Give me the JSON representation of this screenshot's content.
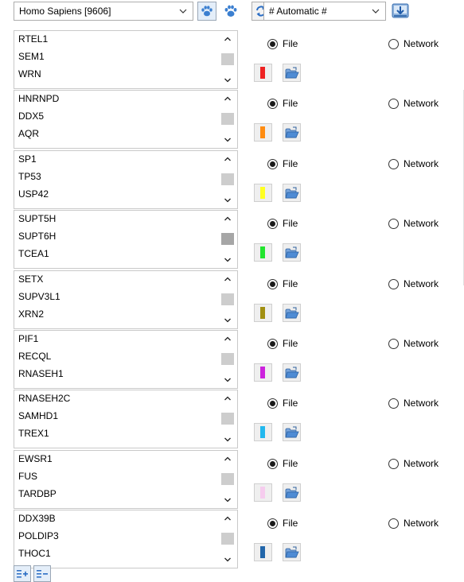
{
  "toolbar": {
    "species": "Homo Sapiens [9606]",
    "mode": "# Automatic #"
  },
  "radio_labels": {
    "file": "File",
    "network": "Network"
  },
  "rows": [
    {
      "genes": [
        "RTEL1",
        "SEM1",
        "WRN"
      ],
      "color": "#ee2222",
      "file_selected": true
    },
    {
      "genes": [
        "HNRNPD",
        "DDX5",
        "AQR"
      ],
      "color": "#ff8c11",
      "file_selected": true
    },
    {
      "genes": [
        "SP1",
        "TP53",
        "USP42"
      ],
      "color": "#ffff22",
      "file_selected": true
    },
    {
      "genes": [
        "SUPT5H",
        "SUPT6H",
        "TCEA1"
      ],
      "color": "#22e52e",
      "file_selected": true
    },
    {
      "genes": [
        "SETX",
        "SUPV3L1",
        "XRN2"
      ],
      "color": "#a18f11",
      "file_selected": true
    },
    {
      "genes": [
        "PIF1",
        "RECQL",
        "RNASEH1"
      ],
      "color": "#cc22dd",
      "file_selected": true
    },
    {
      "genes": [
        "RNASEH2C",
        "SAMHD1",
        "TREX1"
      ],
      "color": "#22b8ee",
      "file_selected": true
    },
    {
      "genes": [
        "EWSR1",
        "FUS",
        "TARDBP"
      ],
      "color": "#f6ccee",
      "file_selected": true
    },
    {
      "genes": [
        "DDX39B",
        "POLDIP3",
        "THOC1"
      ],
      "color": "#2266aa",
      "file_selected": true
    }
  ],
  "icons": {
    "species_chevron": "chevron-down-icon",
    "paw_1": "paw-icon",
    "paw_2": "paw-icon",
    "refresh": "refresh-icon",
    "mode_chevron": "chevron-down-icon",
    "download": "download-icon",
    "color_picker": "color-swatch-icon",
    "folder": "folder-open-icon",
    "add_list": "add-list-icon",
    "remove_list": "remove-list-icon"
  }
}
